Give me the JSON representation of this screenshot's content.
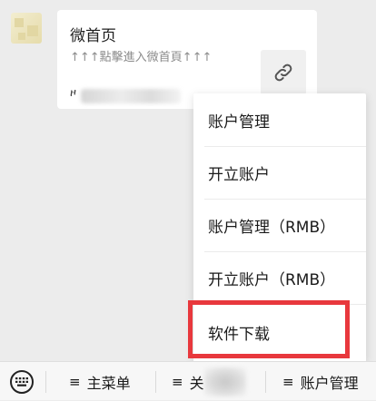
{
  "article_card": {
    "title": "微首页",
    "description": "↑↑↑點擊進入微首頁↑↑↑",
    "source_prefix": "ዞ"
  },
  "popup_menu": {
    "items": [
      {
        "label": "账户管理"
      },
      {
        "label": "开立账户"
      },
      {
        "label": "账户管理（RMB）"
      },
      {
        "label": "开立账户（RMB）"
      },
      {
        "label": "软件下载"
      }
    ],
    "highlighted_index": 4,
    "highlight_color": "#e8383d"
  },
  "bottom_bar": {
    "menu_icon": "≡",
    "items": [
      {
        "label": "主菜单"
      },
      {
        "label": "关"
      },
      {
        "label": "账户管理"
      }
    ]
  }
}
